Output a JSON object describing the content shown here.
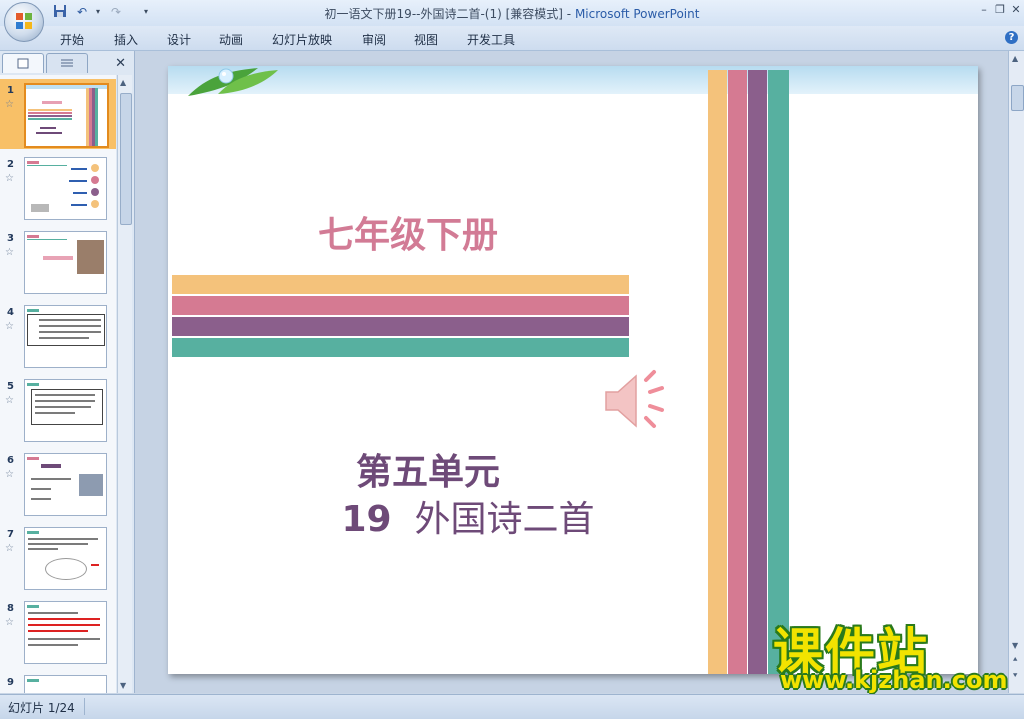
{
  "window": {
    "title": "初一语文下册19--外国诗二首-(1) [兼容模式]",
    "title_separator": " - ",
    "app_name": "Microsoft PowerPoint"
  },
  "quick_access": {
    "icons": [
      "save-icon",
      "undo-icon",
      "redo-icon",
      "customize-icon"
    ]
  },
  "ribbon": {
    "tabs": [
      "开始",
      "插入",
      "设计",
      "动画",
      "幻灯片放映",
      "审阅",
      "视图",
      "开发工具"
    ]
  },
  "slides_panel": {
    "selected": 1,
    "thumbnails": [
      {
        "number": "1"
      },
      {
        "number": "2"
      },
      {
        "number": "3"
      },
      {
        "number": "4"
      },
      {
        "number": "5"
      },
      {
        "number": "6"
      },
      {
        "number": "7"
      },
      {
        "number": "8"
      },
      {
        "number": "9"
      }
    ]
  },
  "slide": {
    "title": "七年级下册",
    "unit": "第五单元",
    "lesson_number": "19",
    "lesson_title": "外国诗二首",
    "colors": {
      "orange": "#f4c27b",
      "pink": "#d57a92",
      "purple": "#8b5f8c",
      "teal": "#57b0a0"
    }
  },
  "watermark": {
    "text": "课件站",
    "url": "www.kjzhan.com"
  },
  "status": {
    "slide_counter": "幻灯片 1/24"
  }
}
